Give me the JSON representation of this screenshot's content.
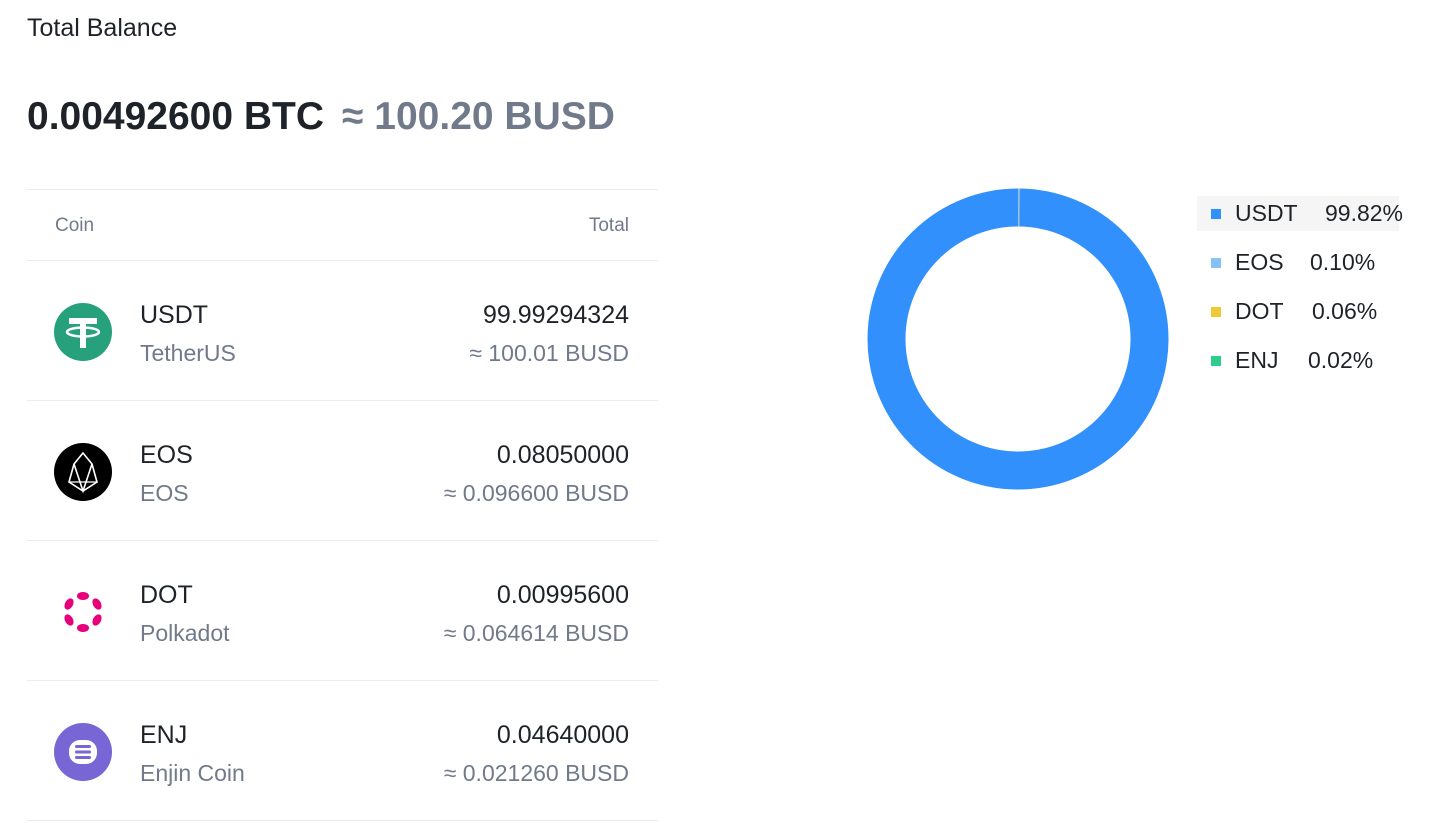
{
  "header": {
    "title": "Total Balance",
    "btc_total": "0.00492600 BTC",
    "busd_total": "≈ 100.20 BUSD"
  },
  "table": {
    "col_coin": "Coin",
    "col_total": "Total",
    "rows": [
      {
        "symbol": "USDT",
        "name": "TetherUS",
        "amount": "99.99294324",
        "value": "≈ 100.01 BUSD",
        "icon": "tether-icon"
      },
      {
        "symbol": "EOS",
        "name": "EOS",
        "amount": "0.08050000",
        "value": "≈ 0.096600 BUSD",
        "icon": "eos-icon"
      },
      {
        "symbol": "DOT",
        "name": "Polkadot",
        "amount": "0.00995600",
        "value": "≈ 0.064614 BUSD",
        "icon": "polkadot-icon"
      },
      {
        "symbol": "ENJ",
        "name": "Enjin Coin",
        "amount": "0.04640000",
        "value": "≈ 0.021260 BUSD",
        "icon": "enjin-icon"
      }
    ]
  },
  "chart_data": {
    "type": "pie",
    "categories": [
      "USDT",
      "EOS",
      "DOT",
      "ENJ"
    ],
    "values": [
      99.82,
      0.1,
      0.06,
      0.02
    ],
    "labels": [
      "99.82%",
      "0.10%",
      "0.06%",
      "0.02%"
    ],
    "colors": [
      "#3290fc",
      "#87c0f5",
      "#f0ca34",
      "#2ecd8e"
    ],
    "legend": "right"
  }
}
